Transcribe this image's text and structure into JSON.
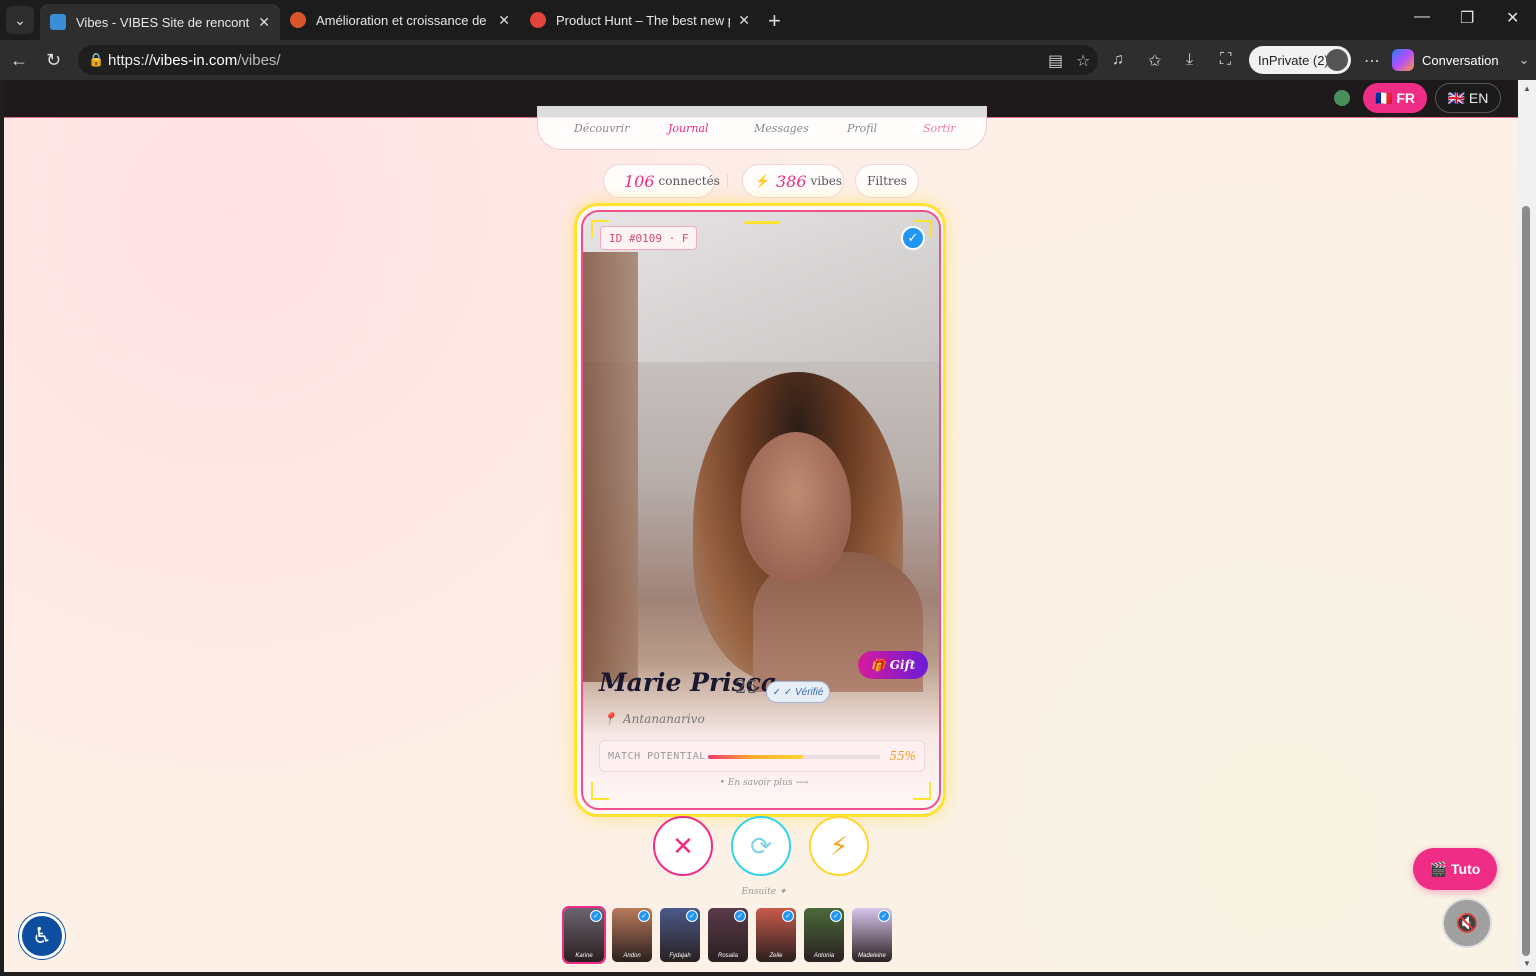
{
  "browser": {
    "tabs": [
      {
        "title": "Vibes - VIBES Site de rencontre : C",
        "active": true,
        "favicon_color": "#3a8ed8"
      },
      {
        "title": "Amélioration et croissance de Vibe",
        "active": false,
        "favicon_color": "#d9542a"
      },
      {
        "title": "Product Hunt – The best new prod",
        "active": false,
        "favicon_color": "#e0443a"
      }
    ],
    "url_prefix": "https://",
    "url_domain": "vibes-in.com",
    "url_path": "/vibes/",
    "inprivate_label": "InPrivate (2)",
    "conversation_label": "Conversation"
  },
  "site": {
    "lang_fr": "🇫🇷 FR",
    "lang_en": "🇬🇧 EN",
    "nav": {
      "discover": "Découvrir",
      "journal": "Journal",
      "messages": "Messages",
      "profile": "Profil",
      "logout": "Sortir"
    },
    "stats": {
      "connected_count": "106",
      "connected_label": "connectés",
      "vibes_count": "386",
      "vibes_label": "vibes",
      "filters_label": "Filtres"
    }
  },
  "profile": {
    "id_badge": "ID #0109 · F",
    "name": "Marie Prisca",
    "age": "25",
    "verified_label": "✓ ✓ Vérifié",
    "city": "Antananarivo",
    "gift_label": "🎁 Gift",
    "match_label": "MATCH POTENTIAL",
    "match_value": "55%",
    "match_fraction": 0.55,
    "learn_more": "• En savoir plus ⟶"
  },
  "actions": {
    "pass_icon": "✕",
    "rewind_icon": "⟳",
    "vibe_icon": "⚡",
    "next_label": "Ensuite ✦"
  },
  "queue": [
    {
      "name": "Karine",
      "color": "#6b6370"
    },
    {
      "name": "Andon",
      "color": "#b87a5a"
    },
    {
      "name": "Fydajah",
      "color": "#4a5a8a"
    },
    {
      "name": "Rosalia",
      "color": "#5a3a4a"
    },
    {
      "name": "Zelie",
      "color": "#c85a4a"
    },
    {
      "name": "Antonia",
      "color": "#4a6a3a"
    },
    {
      "name": "Madeleine",
      "color": "#d9c6ee"
    }
  ],
  "floating": {
    "tuto_label": "🎬 Tuto",
    "mute_icon": "🔇",
    "access_icon": "♿"
  }
}
